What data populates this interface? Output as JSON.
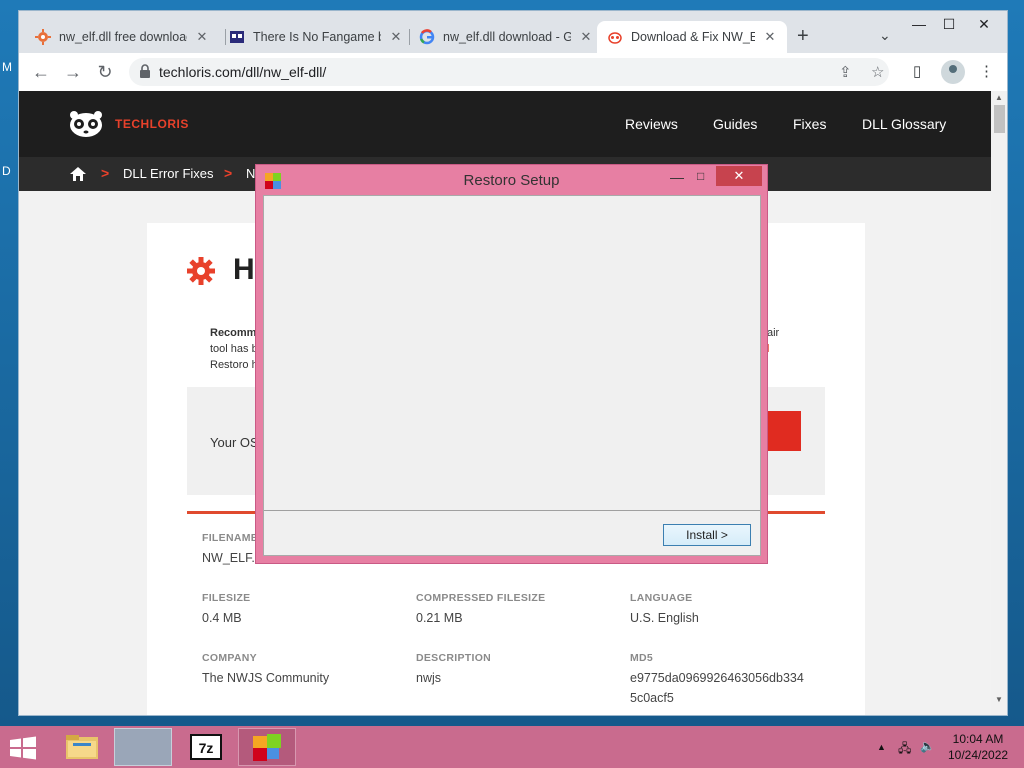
{
  "desktop": {
    "icon_label_1": "M",
    "icon_label_2": "D"
  },
  "browser": {
    "tabs": [
      {
        "title": "nw_elf.dll free download",
        "favicon": "orange-gear-icon"
      },
      {
        "title": "There Is No Fangame by",
        "favicon": "pixel-game-icon"
      },
      {
        "title": "nw_elf.dll download - G",
        "favicon": "google-g-icon"
      },
      {
        "title": "Download & Fix NW_EL",
        "favicon": "panda-icon"
      }
    ],
    "new_tab": "+",
    "tab_menu": "⌄",
    "window_controls": {
      "minimize": "—",
      "maximize": "☐",
      "close": "✕"
    },
    "url": "techloris.com/dll/nw_elf-dll/"
  },
  "site": {
    "brand": "TECHLORIS",
    "nav": [
      "Reviews",
      "Guides",
      "Fixes",
      "DLL Glossary"
    ],
    "breadcrumb": [
      "DLL Error Fixes",
      "N"
    ],
    "heading_fragment": "H",
    "recommend_lines": [
      "Recomm",
      "tool has b",
      "Restoro h"
    ],
    "recommend_right": [
      "air",
      "l"
    ],
    "os_label": "Your OS",
    "meta": [
      {
        "label": "FILENAME",
        "value": "NW_ELF.D"
      },
      {
        "label": "FILESIZE",
        "value": "0.4 MB"
      },
      {
        "label": "COMPRESSED FILESIZE",
        "value": "0.21 MB"
      },
      {
        "label": "LANGUAGE",
        "value": "U.S. English"
      },
      {
        "label": "COMPANY",
        "value": "The NWJS Community"
      },
      {
        "label": "DESCRIPTION",
        "value": "nwjs"
      },
      {
        "label": "MD5",
        "value": "e9775da0969926463056db334",
        "value2": "5c0acf5"
      }
    ],
    "accent": "#e8412b"
  },
  "dialog": {
    "title": "Restoro Setup",
    "min": "—",
    "max": "□",
    "close": "✕",
    "install_label": "Install >"
  },
  "taskbar": {
    "time": "10:04 AM",
    "date": "10/24/2022",
    "tray_arrow": "▲"
  }
}
